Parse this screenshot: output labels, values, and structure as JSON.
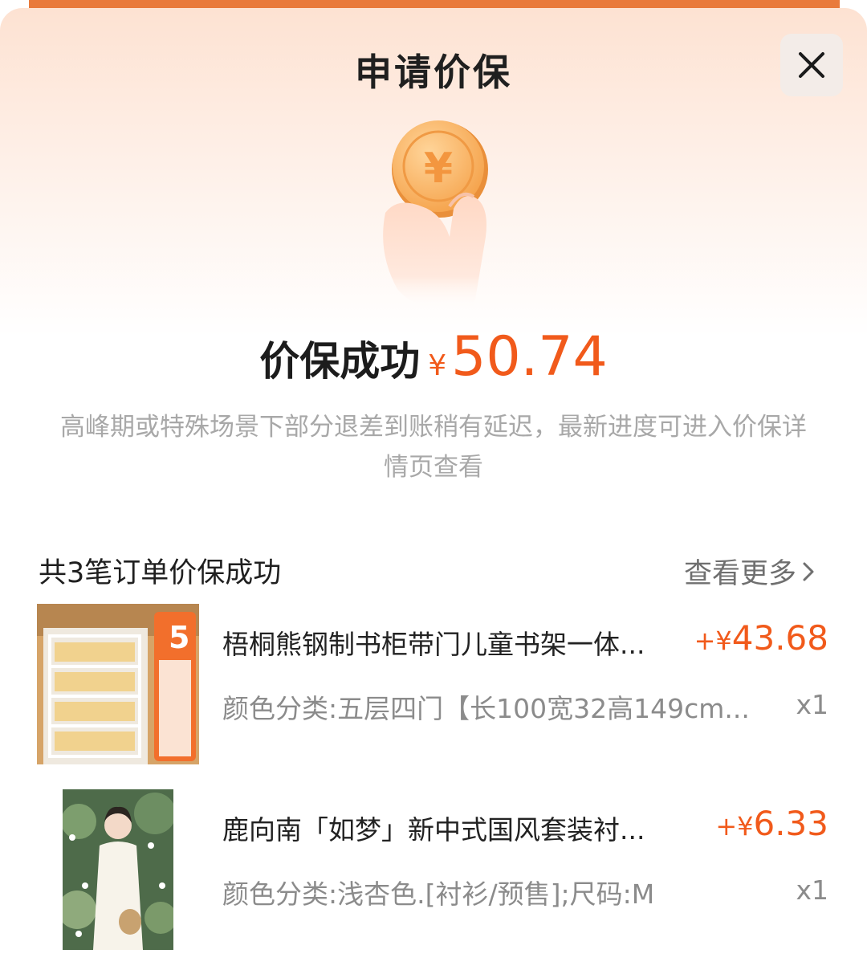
{
  "header": {
    "title": "申请价保",
    "close_icon": "close-icon"
  },
  "result": {
    "label": "价保成功",
    "currency": "¥",
    "amount": "50.74",
    "notice": "高峰期或特殊场景下部分退差到账稍有延迟，最新进度可进入价保详情页查看"
  },
  "orders": {
    "summary": "共3笔订单价保成功",
    "see_more": "查看更多",
    "items": [
      {
        "name": "梧桐熊钢制书柜带门儿童书架一体...",
        "price": "+¥43.68",
        "price_sign": "+¥",
        "price_value": "43.68",
        "spec": "颜色分类:五层四门【长100宽32高149cm...",
        "qty": "x1"
      },
      {
        "name": "鹿向南「如梦」新中式国风套装衬...",
        "price_sign": "+¥",
        "price_value": "6.33",
        "spec": "颜色分类:浅杏色.[衬衫/预售];尺码:M",
        "qty": "x1"
      }
    ]
  },
  "thumb_badge": "5",
  "colors": {
    "accent": "#f15a1b",
    "header_bar": "#e97a3b",
    "coin": "#f7b563"
  }
}
